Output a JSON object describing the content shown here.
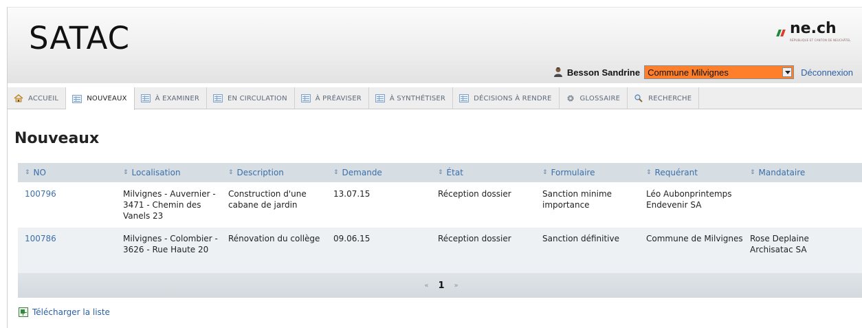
{
  "header": {
    "logo": "SATAC",
    "brand": {
      "name": "ne.ch",
      "subtitle": "RÉPUBLIQUE ET CANTON DE NEUCHÂTEL"
    },
    "user_name": "Besson Sandrine",
    "commune": "Commune Milvignes",
    "logout": "Déconnexion"
  },
  "tabs": [
    {
      "label": "ACCUEIL",
      "icon": "home-icon"
    },
    {
      "label": "NOUVEAUX",
      "icon": "grid-icon",
      "active": true
    },
    {
      "label": "À EXAMINER",
      "icon": "grid-icon"
    },
    {
      "label": "EN CIRCULATION",
      "icon": "grid-icon"
    },
    {
      "label": "À PRÉAVISER",
      "icon": "grid-icon"
    },
    {
      "label": "À SYNTHÉTISER",
      "icon": "grid-icon"
    },
    {
      "label": "DÉCISIONS À RENDRE",
      "icon": "grid-icon"
    },
    {
      "label": "GLOSSAIRE",
      "icon": "gear-icon"
    },
    {
      "label": "RECHERCHE",
      "icon": "search-icon"
    }
  ],
  "page": {
    "title": "Nouveaux"
  },
  "table": {
    "columns": [
      "NO",
      "Localisation",
      "Description",
      "Demande",
      "État",
      "Formulaire",
      "Requérant",
      "Mandataire"
    ],
    "rows": [
      {
        "no": "100796",
        "localisation": "Milvignes - Auvernier - 3471 - Chemin des Vanels 23",
        "description": "Construction d'une cabane de jardin",
        "demande": "13.07.15",
        "etat": "Réception dossier",
        "formulaire": "Sanction minime importance",
        "requerant": "Léo Aubonprintemps Endevenir SA",
        "mandataire": ""
      },
      {
        "no": "100786",
        "localisation": "Milvignes - Colombier - 3626 - Rue Haute 20",
        "description": "Rénovation du collège",
        "demande": "09.06.15",
        "etat": "Réception dossier",
        "formulaire": "Sanction définitive",
        "requerant": "Commune de Milvignes",
        "mandataire": "Rose Deplaine Archisatac SA"
      }
    ],
    "pager": {
      "prev": "«",
      "current": "1",
      "next": "»"
    }
  },
  "download": {
    "label": "Télécharger la liste"
  },
  "colors": {
    "commune_select_bg": "#ff7f2a",
    "link": "#3b6fa8",
    "header_row": "#d6dde3"
  }
}
